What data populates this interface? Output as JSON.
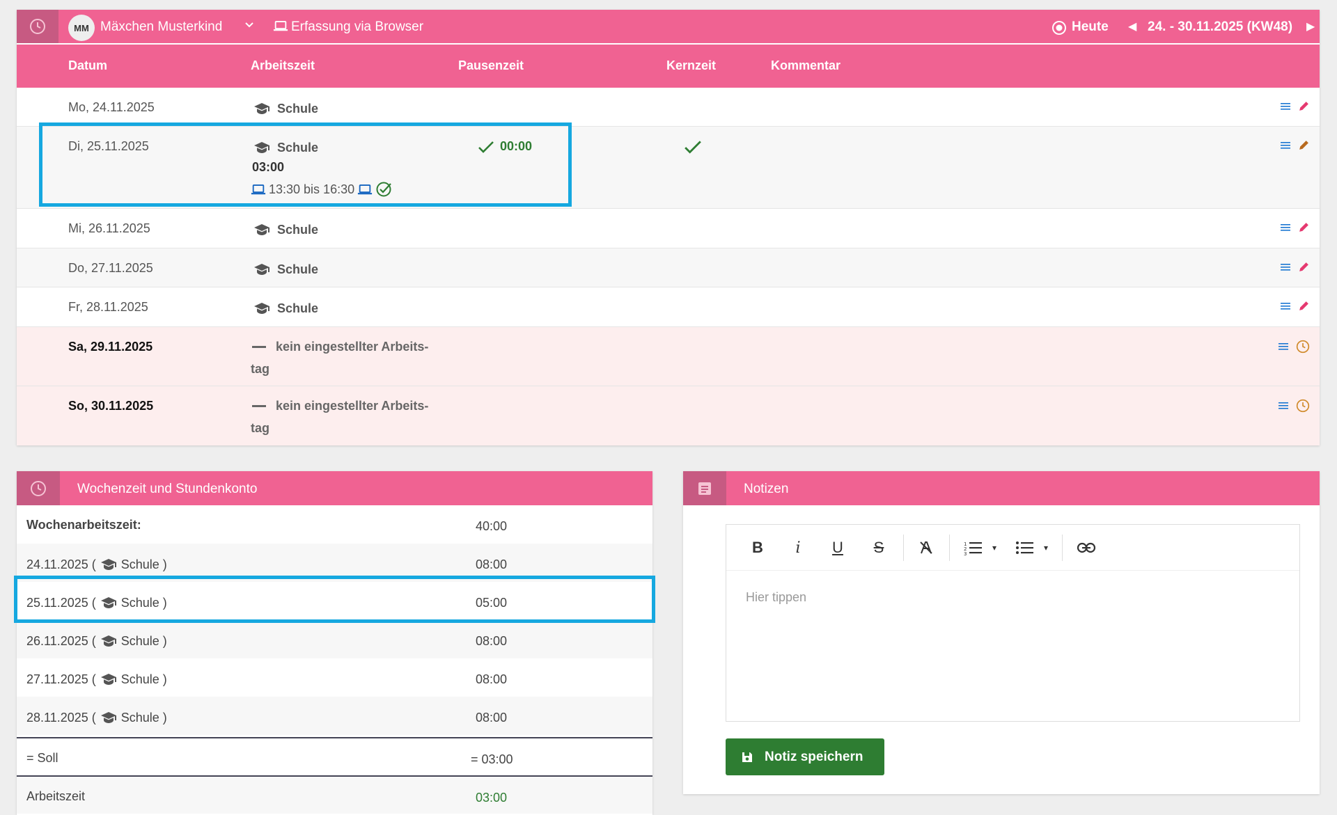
{
  "topbar": {
    "initials": "MM",
    "user": "Mäxchen Musterkind",
    "mode": "Erfassung via Browser",
    "today": "Heute",
    "range": "24. - 30.11.2025 (KW48)"
  },
  "table": {
    "headers": [
      "Datum",
      "Arbeitszeit",
      "Pausenzeit",
      "Kernzeit",
      "Kommentar"
    ],
    "rows": [
      {
        "date": "Mo, 24.11.2025",
        "work": "Schule"
      },
      {
        "date": "Di, 25.11.2025",
        "work": "Schule",
        "duration": "03:00",
        "times": "13:30 bis 16:30",
        "pause": "00:00"
      },
      {
        "date": "Mi, 26.11.2025",
        "work": "Schule"
      },
      {
        "date": "Do, 27.11.2025",
        "work": "Schule"
      },
      {
        "date": "Fr, 28.11.2025",
        "work": "Schule"
      },
      {
        "date": "Sa, 29.11.2025",
        "work": "kein eingestellter Arbeits-",
        "work2": "tag"
      },
      {
        "date": "So, 30.11.2025",
        "work": "kein eingestellter Arbeits-",
        "work2": "tag"
      }
    ]
  },
  "account": {
    "title": "Wochenzeit und Stundenkonto",
    "rows": [
      {
        "label": "Wochenarbeitszeit:",
        "value": "40:00"
      },
      {
        "date": "24.11.2025 (",
        "type": "Schule )",
        "value": "08:00"
      },
      {
        "date": "25.11.2025 (",
        "type": "Schule )",
        "value": "05:00"
      },
      {
        "date": "26.11.2025 (",
        "type": "Schule )",
        "value": "08:00"
      },
      {
        "date": "27.11.2025 (",
        "type": "Schule )",
        "value": "08:00"
      },
      {
        "date": "28.11.2025 (",
        "type": "Schule )",
        "value": "08:00"
      },
      {
        "label": "= Soll",
        "value": "= 03:00"
      },
      {
        "label": "Arbeitszeit",
        "value": "03:00"
      }
    ]
  },
  "notes": {
    "title": "Notizen",
    "placeholder": "Hier tippen",
    "toolbar": {
      "bold": "B",
      "italic": "i",
      "underline": "U",
      "strike": "S"
    },
    "save": "Notiz speichern"
  },
  "colors": {
    "primary": "#f06292",
    "primary_dark": "#c75a82",
    "highlight": "#16a8e0",
    "success": "#2e7d32"
  }
}
